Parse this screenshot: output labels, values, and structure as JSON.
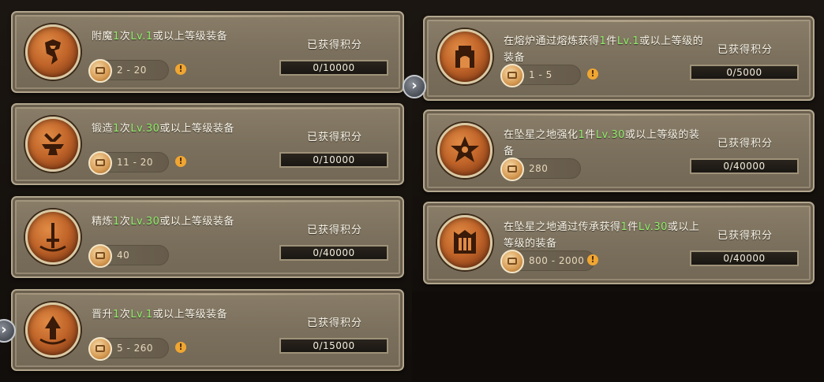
{
  "earned_label": "已获得积分",
  "tasks": [
    {
      "id": "enchant",
      "title_pre": "附魔",
      "title_g1": "1",
      "title_mid": "次",
      "title_g2": "Lv.1",
      "title_post": "或以上等级装备",
      "reward": "2 - 20",
      "progress": "0/10000",
      "icon": "enchant-rune-icon"
    },
    {
      "id": "forge",
      "title_pre": "锻造",
      "title_g1": "1",
      "title_mid": "次",
      "title_g2": "Lv.30",
      "title_post": "或以上等级装备",
      "reward": "11 - 20",
      "progress": "0/10000",
      "icon": "anvil-hammer-icon"
    },
    {
      "id": "refine",
      "title_pre": "精炼",
      "title_g1": "1",
      "title_mid": "次",
      "title_g2": "Lv.30",
      "title_post": "或以上等级装备",
      "reward": "40",
      "progress": "0/40000",
      "icon": "sword-refine-icon"
    },
    {
      "id": "promote",
      "title_pre": "晋升",
      "title_g1": "1",
      "title_mid": "次",
      "title_g2": "Lv.1",
      "title_post": "或以上等级装备",
      "reward": "5 - 260",
      "progress": "0/15000",
      "icon": "arrow-promote-icon"
    },
    {
      "id": "smelt",
      "title_pre": "在熔炉通过熔炼获得",
      "title_g1": "1",
      "title_mid": "件",
      "title_g2": "Lv.1",
      "title_post": "或以上等级的装备",
      "reward": "1 - 5",
      "progress": "0/5000",
      "icon": "furnace-icon"
    },
    {
      "id": "star-strengthen",
      "title_pre": "在坠星之地强化",
      "title_g1": "1",
      "title_mid": "件",
      "title_g2": "Lv.30",
      "title_post": "或以上等级的装备",
      "reward": "280",
      "progress": "0/40000",
      "icon": "star-emblem-icon"
    },
    {
      "id": "star-inherit",
      "title_pre": "在坠星之地通过传承获得",
      "title_g1": "1",
      "title_mid": "件",
      "title_g2": "Lv.30",
      "title_post": "或以上等级的装备",
      "reward": "800 - 2000",
      "progress": "0/40000",
      "icon": "gate-inherit-icon"
    }
  ]
}
